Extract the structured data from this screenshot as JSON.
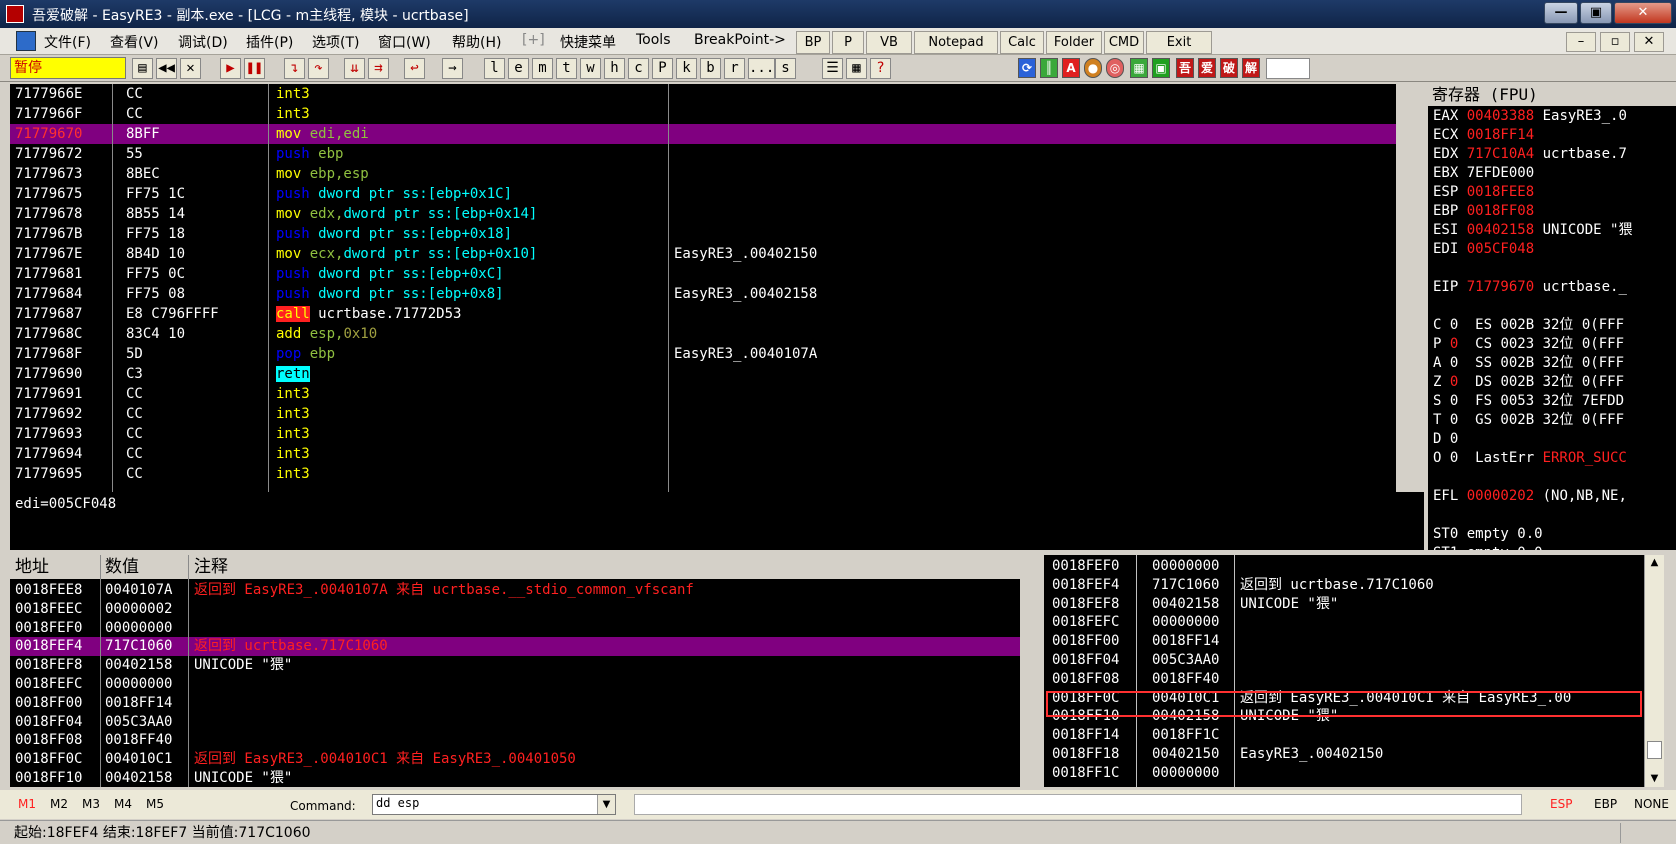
{
  "window": {
    "title": "吾爱破解 - EasyRE3 - 副本.exe - [LCG - m主线程, 模块 - ucrtbase]",
    "min": "—",
    "max": "▣",
    "close": "✕"
  },
  "menu": {
    "items": [
      "文件(F)",
      "查看(V)",
      "调试(D)",
      "插件(P)",
      "选项(T)",
      "窗口(W)",
      "帮助(H)",
      "[+]",
      "快捷菜单",
      "Tools",
      "BreakPoint->"
    ],
    "tool_buttons": [
      "BP",
      "P",
      "VB",
      "Notepad",
      "Calc",
      "Folder",
      "CMD",
      "Exit"
    ],
    "mdi_controls": [
      "–",
      "▫",
      "✕"
    ]
  },
  "toolbar": {
    "status": "暂停",
    "letters": [
      "l",
      "e",
      "m",
      "t",
      "w",
      "h",
      "c",
      "P",
      "k",
      "b",
      "r",
      "...",
      "s"
    ],
    "plugin_icons": [
      "吾",
      "爱",
      "破",
      "解"
    ],
    "help": "?"
  },
  "cpu": {
    "rows": [
      {
        "addr": "7177966E",
        "hex": "CC",
        "asm": [
          {
            "t": "int3",
            "c": "yel"
          }
        ],
        "cmt": ""
      },
      {
        "addr": "7177966F",
        "hex": "CC",
        "asm": [
          {
            "t": "int3",
            "c": "yel"
          }
        ],
        "cmt": ""
      },
      {
        "addr": "71779670",
        "hex": "8BFF",
        "asm": [
          {
            "t": "mov ",
            "c": "yel"
          },
          {
            "t": "edi,edi",
            "c": "grn"
          }
        ],
        "cmt": "",
        "selected": true
      },
      {
        "addr": "71779672",
        "hex": "55",
        "asm": [
          {
            "t": "push ",
            "c": "blu"
          },
          {
            "t": "ebp",
            "c": "grn"
          }
        ],
        "cmt": ""
      },
      {
        "addr": "71779673",
        "hex": "8BEC",
        "asm": [
          {
            "t": "mov ",
            "c": "yel"
          },
          {
            "t": "ebp,esp",
            "c": "grn"
          }
        ],
        "cmt": ""
      },
      {
        "addr": "71779675",
        "hex": "FF75 1C",
        "asm": [
          {
            "t": "push ",
            "c": "blu"
          },
          {
            "t": "dword ptr ss:[ebp+0x1C]",
            "c": "cyn"
          }
        ],
        "cmt": ""
      },
      {
        "addr": "71779678",
        "hex": "8B55 14",
        "asm": [
          {
            "t": "mov ",
            "c": "yel"
          },
          {
            "t": "edx,",
            "c": "grn"
          },
          {
            "t": "dword ptr ss:[ebp+0x14]",
            "c": "cyn"
          }
        ],
        "cmt": ""
      },
      {
        "addr": "7177967B",
        "hex": "FF75 18",
        "asm": [
          {
            "t": "push ",
            "c": "blu"
          },
          {
            "t": "dword ptr ss:[ebp+0x18]",
            "c": "cyn"
          }
        ],
        "cmt": ""
      },
      {
        "addr": "7177967E",
        "hex": "8B4D 10",
        "asm": [
          {
            "t": "mov ",
            "c": "yel"
          },
          {
            "t": "ecx,",
            "c": "grn"
          },
          {
            "t": "dword ptr ss:[ebp+0x10]",
            "c": "cyn"
          }
        ],
        "cmt": "EasyRE3_.00402150"
      },
      {
        "addr": "71779681",
        "hex": "FF75 0C",
        "asm": [
          {
            "t": "push ",
            "c": "blu"
          },
          {
            "t": "dword ptr ss:[ebp+0xC]",
            "c": "cyn"
          }
        ],
        "cmt": ""
      },
      {
        "addr": "71779684",
        "hex": "FF75 08",
        "asm": [
          {
            "t": "push ",
            "c": "blu"
          },
          {
            "t": "dword ptr ss:[ebp+0x8]",
            "c": "cyn"
          }
        ],
        "cmt": "EasyRE3_.00402158"
      },
      {
        "addr": "71779687",
        "hex": "E8 C796FFFF",
        "asm": [
          {
            "t": "call",
            "c": "callbox"
          },
          {
            "t": " ucrtbase.71772D53",
            "c": "wht"
          }
        ],
        "cmt": ""
      },
      {
        "addr": "7177968C",
        "hex": "83C4 10",
        "asm": [
          {
            "t": "add ",
            "c": "yel"
          },
          {
            "t": "esp,",
            "c": "grn"
          },
          {
            "t": "0x10",
            "c": "olv"
          }
        ],
        "cmt": ""
      },
      {
        "addr": "7177968F",
        "hex": "5D",
        "asm": [
          {
            "t": "pop ",
            "c": "blu"
          },
          {
            "t": "ebp",
            "c": "grn"
          }
        ],
        "cmt": "EasyRE3_.0040107A"
      },
      {
        "addr": "71779690",
        "hex": "C3",
        "asm": [
          {
            "t": "retn",
            "c": "retnbox"
          }
        ],
        "cmt": ""
      },
      {
        "addr": "71779691",
        "hex": "CC",
        "asm": [
          {
            "t": "int3",
            "c": "yel"
          }
        ],
        "cmt": ""
      },
      {
        "addr": "71779692",
        "hex": "CC",
        "asm": [
          {
            "t": "int3",
            "c": "yel"
          }
        ],
        "cmt": ""
      },
      {
        "addr": "71779693",
        "hex": "CC",
        "asm": [
          {
            "t": "int3",
            "c": "yel"
          }
        ],
        "cmt": ""
      },
      {
        "addr": "71779694",
        "hex": "CC",
        "asm": [
          {
            "t": "int3",
            "c": "yel"
          }
        ],
        "cmt": ""
      },
      {
        "addr": "71779695",
        "hex": "CC",
        "asm": [
          {
            "t": "int3",
            "c": "yel"
          }
        ],
        "cmt": ""
      }
    ]
  },
  "info_line": "edi=005CF048",
  "registers": {
    "header": "寄存器 (FPU)",
    "rows": [
      [
        {
          "t": "EAX ",
          "c": "wht"
        },
        {
          "t": "00403388",
          "c": "red"
        },
        {
          "t": " EasyRE3_.0",
          "c": "wht"
        }
      ],
      [
        {
          "t": "ECX ",
          "c": "wht"
        },
        {
          "t": "0018FF14",
          "c": "red"
        }
      ],
      [
        {
          "t": "EDX ",
          "c": "wht"
        },
        {
          "t": "717C10A4",
          "c": "red"
        },
        {
          "t": " ucrtbase.7",
          "c": "wht"
        }
      ],
      [
        {
          "t": "EBX 7EFDE000",
          "c": "wht"
        }
      ],
      [
        {
          "t": "ESP ",
          "c": "wht"
        },
        {
          "t": "0018FEE8",
          "c": "red"
        }
      ],
      [
        {
          "t": "EBP ",
          "c": "wht"
        },
        {
          "t": "0018FF08",
          "c": "red"
        }
      ],
      [
        {
          "t": "ESI ",
          "c": "wht"
        },
        {
          "t": "00402158",
          "c": "red"
        },
        {
          "t": " UNICODE \"猥",
          "c": "wht"
        }
      ],
      [
        {
          "t": "EDI ",
          "c": "wht"
        },
        {
          "t": "005CF048",
          "c": "red"
        }
      ],
      [],
      [
        {
          "t": "EIP ",
          "c": "wht"
        },
        {
          "t": "71779670",
          "c": "red"
        },
        {
          "t": " ucrtbase._",
          "c": "wht"
        }
      ],
      [],
      [
        {
          "t": "C 0  ES 002B 32位 0(FFF",
          "c": "wht"
        }
      ],
      [
        {
          "t": "P ",
          "c": "wht"
        },
        {
          "t": "0",
          "c": "red"
        },
        {
          "t": "  CS 0023 32位 0(FFF",
          "c": "wht"
        }
      ],
      [
        {
          "t": "A 0  SS 002B 32位 0(FFF",
          "c": "wht"
        }
      ],
      [
        {
          "t": "Z ",
          "c": "wht"
        },
        {
          "t": "0",
          "c": "red"
        },
        {
          "t": "  DS 002B 32位 0(FFF",
          "c": "wht"
        }
      ],
      [
        {
          "t": "S 0  FS 0053 32位 7EFDD",
          "c": "wht"
        }
      ],
      [
        {
          "t": "T 0  GS 002B 32位 0(FFF",
          "c": "wht"
        }
      ],
      [
        {
          "t": "D 0",
          "c": "wht"
        }
      ],
      [
        {
          "t": "O 0  LastErr ",
          "c": "wht"
        },
        {
          "t": "ERROR_SUCC",
          "c": "red"
        }
      ],
      [],
      [
        {
          "t": "EFL ",
          "c": "wht"
        },
        {
          "t": "00000202",
          "c": "red"
        },
        {
          "t": " (NO,NB,NE,",
          "c": "wht"
        }
      ],
      [],
      [
        {
          "t": "ST0 empty 0.0",
          "c": "wht"
        }
      ],
      [
        {
          "t": "ST1 empty 0.0",
          "c": "wht"
        }
      ]
    ]
  },
  "dump": {
    "headers": [
      "地址",
      "数值",
      "注释"
    ],
    "rows": [
      {
        "a": "0018FEE8",
        "v": "0040107A",
        "c": "返回到 EasyRE3_.0040107A 来自 ucrtbase.__stdio_common_vfscanf",
        "red": true
      },
      {
        "a": "0018FEEC",
        "v": "00000002",
        "c": ""
      },
      {
        "a": "0018FEF0",
        "v": "00000000",
        "c": ""
      },
      {
        "a": "0018FEF4",
        "v": "717C1060",
        "c": "返回到 ucrtbase.717C1060",
        "red": true,
        "selected": true
      },
      {
        "a": "0018FEF8",
        "v": "00402158",
        "c": "UNICODE \"猥\""
      },
      {
        "a": "0018FEFC",
        "v": "00000000",
        "c": ""
      },
      {
        "a": "0018FF00",
        "v": "0018FF14",
        "c": ""
      },
      {
        "a": "0018FF04",
        "v": "005C3AA0",
        "c": ""
      },
      {
        "a": "0018FF08",
        "v": "0018FF40",
        "c": ""
      },
      {
        "a": "0018FF0C",
        "v": "004010C1",
        "c": "返回到 EasyRE3_.004010C1 来自 EasyRE3_.00401050",
        "red": true
      },
      {
        "a": "0018FF10",
        "v": "00402158",
        "c": "UNICODE \"猥\""
      }
    ]
  },
  "stack": {
    "rows": [
      {
        "a": "0018FEF0",
        "v": "00000000",
        "c": ""
      },
      {
        "a": "0018FEF4",
        "v": "717C1060",
        "c": "返回到 ucrtbase.717C1060"
      },
      {
        "a": "0018FEF8",
        "v": "00402158",
        "c": "UNICODE \"猥\""
      },
      {
        "a": "0018FEFC",
        "v": "00000000",
        "c": ""
      },
      {
        "a": "0018FF00",
        "v": "0018FF14",
        "c": ""
      },
      {
        "a": "0018FF04",
        "v": "005C3AA0",
        "c": ""
      },
      {
        "a": "0018FF08",
        "v": "0018FF40",
        "c": ""
      },
      {
        "a": "0018FF0C",
        "v": "004010C1",
        "c": "返回到 EasyRE3_.004010C1 来自 EasyRE3_.00",
        "highlight": true
      },
      {
        "a": "0018FF10",
        "v": "00402158",
        "c": "UNICODE \"猥\""
      },
      {
        "a": "0018FF14",
        "v": "0018FF1C",
        "c": ""
      },
      {
        "a": "0018FF18",
        "v": "00402150",
        "c": "EasyRE3_.00402150"
      },
      {
        "a": "0018FF1C",
        "v": "00000000",
        "c": ""
      }
    ]
  },
  "bottom": {
    "tabs": [
      "M1",
      "M2",
      "M3",
      "M4",
      "M5"
    ],
    "command_label": "Command:",
    "command_value": "dd esp",
    "right": [
      "ESP",
      "EBP",
      "NONE"
    ]
  },
  "status": "起始:18FEF4 结束:18FEF7 当前值:717C1060",
  "colors": {
    "selection": "#800080",
    "accent_red": "#ff2020",
    "asm_yellow": "#ffff00",
    "asm_blue": "#0000ff",
    "asm_cyan": "#00ffff",
    "highlight_border": "#ff3030"
  }
}
